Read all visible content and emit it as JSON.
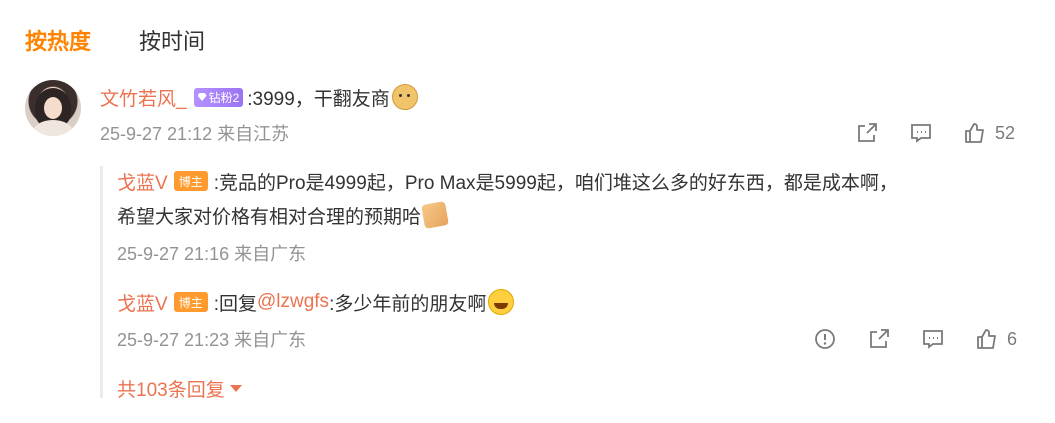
{
  "tabs": [
    {
      "label": "按热度",
      "active": true
    },
    {
      "label": "按时间",
      "active": false
    }
  ],
  "comment": {
    "username": "文竹若风_",
    "fan_badge": "钻粉2",
    "text": ":3999，干翻友商",
    "emoji": "doge-emoji",
    "meta": "25-9-27 21:12 来自江苏",
    "like_count": "52"
  },
  "replies": [
    {
      "username": "戈蓝V",
      "badge": "博主",
      "text_line1": ":竞品的Pro是4999起，Pro Max是5999起，咱们堆这么多的好东西，都是成本啊，",
      "text_line2": "希望大家对价格有相对合理的预期哈",
      "emoji": "pray-hands-emoji",
      "meta": "25-9-27 21:16 来自广东"
    },
    {
      "username": "戈蓝V",
      "badge": "博主",
      "prefix": ":回复",
      "mention": "@lzwgfs",
      "text": ":多少年前的朋友啊",
      "emoji": "laughing-tears-emoji",
      "meta": "25-9-27 21:23 来自广东",
      "like_count": "6"
    }
  ],
  "more_replies": "共103条回复",
  "colors": {
    "accent": "#ff8200",
    "username": "#eb7350",
    "meta": "#939393",
    "host_badge": "#ff9a2e",
    "fan_badge": "#a87ff7"
  }
}
